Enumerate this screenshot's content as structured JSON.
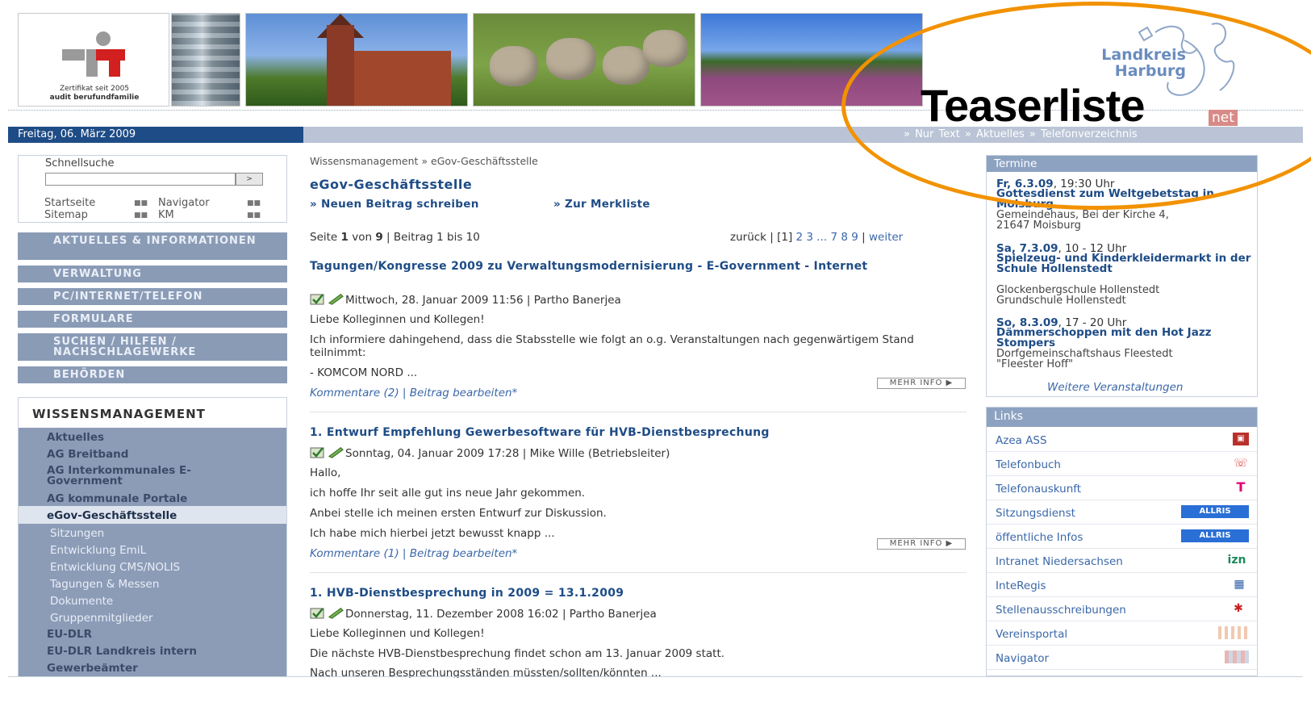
{
  "header": {
    "logo_text_line1": "Zertifikat seit 2005",
    "logo_text_line2": "audit berufundfamilie",
    "brand_line1": "Landkreis",
    "brand_line2": "Harburg",
    "intranet_label": "net"
  },
  "datebar": {
    "date": "Freitag, 06. März 2009",
    "links": "» Nur Text    » Aktuelles    » Telefonverzeichnis"
  },
  "quicksearch": {
    "label": "Schnellsuche",
    "go": ">",
    "links": [
      "Startseite",
      "Navigator",
      "Sitemap",
      "KM"
    ]
  },
  "nav": [
    "AKTUELLES & INFORMATIONEN",
    "VERWALTUNG",
    "PC/INTERNET/TELEFON",
    "FORMULARE",
    "SUCHEN / HILFEN / NACHSCHLAGEWERKE",
    "BEHÖRDEN"
  ],
  "wissensmanagement": {
    "title": "WISSENSMANAGEMENT",
    "items": [
      "Aktuelles",
      "AG Breitband",
      "AG Interkommunales E-Government",
      "AG kommunale Portale",
      "eGov-Geschäftsstelle",
      "Sitzungen",
      "Entwicklung EmiL",
      "Entwicklung CMS/NOLIS",
      "Tagungen & Messen",
      "Dokumente",
      "Gruppenmitglieder",
      "EU-DLR",
      "EU-DLR Landkreis intern",
      "Gewerbeämter"
    ]
  },
  "main": {
    "breadcrumb": "Wissensmanagement » eGov-Geschäftsstelle",
    "title": "eGov-Geschäftsstelle",
    "new_post": "» Neuen Beitrag schreiben",
    "bookmark": "» Zur Merkliste",
    "pager_left_a": "Seite ",
    "pager_page": "1",
    "pager_left_b": " von ",
    "pager_total": "9",
    "pager_left_c": " | Beitrag 1 bis 10",
    "pager_back": "zurück | [1] ",
    "pager_pages": "2 3 ... 7 8 9",
    "pager_sep": " | ",
    "pager_next": "weiter",
    "mehr_info": "MEHR INFO ▶",
    "articles": [
      {
        "title": "Tagungen/Kongresse 2009 zu Verwaltungsmodernisierung - E-Government - Internet",
        "meta": "Mittwoch, 28. Januar 2009 11:56 | Partho Banerjea",
        "lines": [
          "Liebe Kolleginnen und Kollegen!",
          "Ich informiere dahingehend, dass die Stabsstelle wie folgt an o.g. Veranstaltungen nach gegenwärtigem Stand teilnimmt:",
          "- KOMCOM NORD ..."
        ],
        "comments": "Kommentare (2)",
        "edit": "Beitrag bearbeiten*"
      },
      {
        "title": "1. Entwurf Empfehlung Gewerbesoftware für HVB-Dienstbesprechung",
        "meta": "Sonntag, 04. Januar 2009 17:28 | Mike Wille (Betriebsleiter)",
        "lines": [
          "Hallo,",
          "ich hoffe Ihr seit alle gut ins neue Jahr gekommen.",
          "Anbei stelle ich meinen ersten Entwurf zur Diskussion.",
          "Ich habe mich hierbei jetzt bewusst knapp ..."
        ],
        "comments": "Kommentare (1)",
        "edit": "Beitrag bearbeiten*"
      },
      {
        "title": "1. HVB-Dienstbesprechung in 2009 = 13.1.2009",
        "meta": "Donnerstag, 11. Dezember 2008 16:02 | Partho Banerjea",
        "lines": [
          "Liebe Kolleginnen und Kollegen!",
          "Die nächste HVB-Dienstbesprechung findet schon am 13. Januar 2009 statt.",
          "Nach unseren Besprechungsständen müssten/sollten/könnten ..."
        ]
      }
    ]
  },
  "termine": {
    "label": "Termine",
    "events": [
      {
        "date_b": "Fr, 6.3.09",
        "time": ", 19:30 Uhr",
        "title": "Gottesdienst zum Weltgebetstag in Moisburg",
        "loc": [
          "Gemeindehaus, Bei der Kirche 4,",
          "21647 Moisburg"
        ]
      },
      {
        "date_b": "Sa, 7.3.09",
        "time": ", 10 - 12 Uhr",
        "title": "Spielzeug- und Kinderkleidermarkt in der Schule Hollenstedt",
        "loc": [
          "Glockenbergschule Hollenstedt",
          "Grundschule Hollenstedt"
        ]
      },
      {
        "date_b": "So, 8.3.09",
        "time": ", 17 - 20 Uhr",
        "title": "Dämmerschoppen mit den Hot Jazz Stompers",
        "loc": [
          "Dorfgemeinschaftshaus Fleestedt",
          "\"Fleester Hoff\""
        ]
      }
    ],
    "more": "Weitere Veranstaltungen"
  },
  "links": {
    "label": "Links",
    "items": [
      {
        "label": "Azea ASS",
        "icon": "book-icon"
      },
      {
        "label": "Telefonbuch",
        "icon": "phone-icon"
      },
      {
        "label": "Telefonauskunft",
        "icon": "telekom-icon"
      },
      {
        "label": "Sitzungsdienst",
        "icon": "allris-icon"
      },
      {
        "label": "öffentliche Infos",
        "icon": "allris-icon"
      },
      {
        "label": "Intranet Niedersachsen",
        "icon": "izn-icon"
      },
      {
        "label": "InteRegis",
        "icon": "map-icon"
      },
      {
        "label": "Stellenausschreibungen",
        "icon": "people-icon"
      },
      {
        "label": "Vereinsportal",
        "icon": "portal-icon"
      },
      {
        "label": "Navigator",
        "icon": "navigator-icon"
      }
    ]
  },
  "overlay": {
    "label": "Teaserliste",
    "color": "#f29200"
  }
}
